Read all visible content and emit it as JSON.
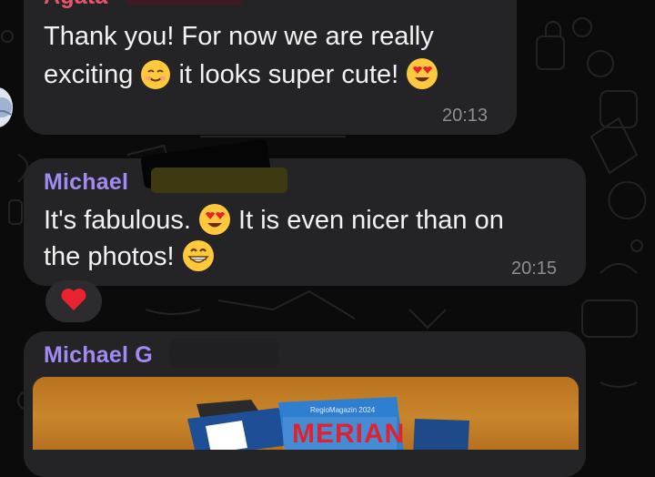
{
  "colors": {
    "background": "#0b0b0b",
    "bubble": "#242426",
    "sender_agata": "#e8566e",
    "sender_michael": "#a589f2",
    "text": "#f2f2f2",
    "time": "#8e8e92"
  },
  "messages": [
    {
      "sender": "Agata",
      "line1": "Thank you! For now we are really",
      "line2_a": "exciting",
      "line2_b": "it looks super cute!",
      "time": "20:13",
      "emojis": [
        "smiling-face-icon",
        "heart-eyes-icon"
      ]
    },
    {
      "sender": "Michael",
      "line1_a": "It's fabulous.",
      "line1_b": "It is even nicer than on",
      "line2": "the photos!",
      "time": "20:15",
      "emojis": [
        "heart-eyes-icon",
        "grinning-face-icon"
      ],
      "reaction": "red-heart-icon"
    },
    {
      "sender": "Michael",
      "sender_initial": "G",
      "attachment": "photo",
      "photo_texts": [
        "RegioMagazin 2024",
        "MERIAN"
      ]
    }
  ]
}
